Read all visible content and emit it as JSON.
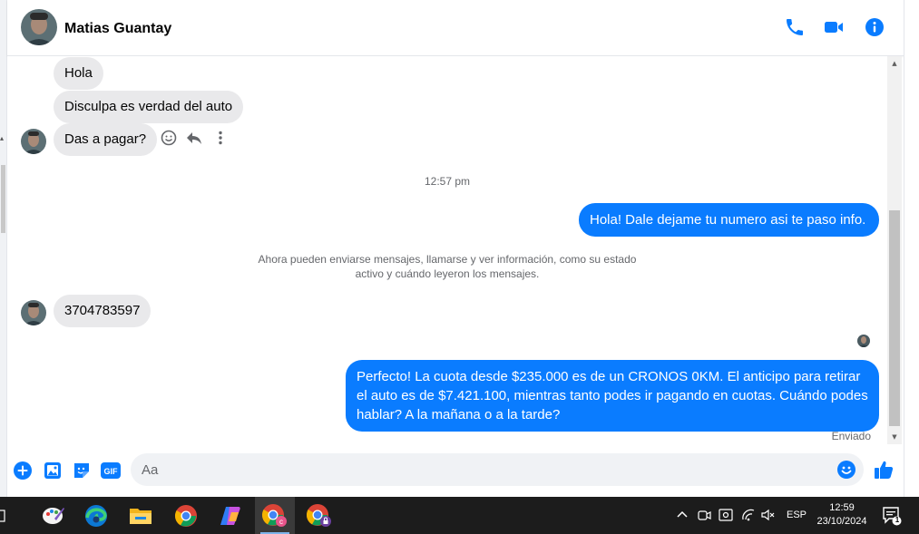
{
  "header": {
    "contact_name": "Matias Guantay",
    "icons": [
      "phone-icon",
      "video-camera-icon",
      "info-icon"
    ],
    "accent_color": "#0a7cff"
  },
  "messages": {
    "incoming_1": "Hola",
    "incoming_2": "Disculpa es verdad del auto",
    "incoming_3": "Das a pagar?",
    "timestamp": "12:57 pm",
    "outgoing_1": "Hola! Dale dejame tu numero  asi te paso info.",
    "notice_line_1": "Ahora pueden enviarse mensajes, llamarse y ver información, como su estado",
    "notice_line_2": "activo y cuándo leyeron los mensajes.",
    "incoming_4": "3704783597",
    "outgoing_2": "Perfecto! La cuota desde $235.000 es de un CRONOS 0KM. El anticipo para retirar el auto es de $7.421.100, mientras tanto podes ir pagando en cuotas. Cuándo podes hablar? A la mañana o a la tarde?",
    "status": "Enviado",
    "hover_actions": [
      "smile-react-icon",
      "reply-icon",
      "more-options-icon"
    ]
  },
  "composer": {
    "placeholder": "Aa",
    "gif_label": "GIF",
    "icons": [
      "plus-icon",
      "image-icon",
      "sticker-icon",
      "gif-icon",
      "emoji-icon",
      "thumbs-up-icon"
    ]
  },
  "taskbar": {
    "apps": [
      "paint-app-icon",
      "edge-icon",
      "file-explorer-icon",
      "chrome-icon",
      "copilot-icon",
      "chrome-profile-c-icon",
      "chrome-profile-locked-icon"
    ],
    "language": "ESP",
    "time": "12:59",
    "date": "23/10/2024",
    "notification_count": "1"
  }
}
